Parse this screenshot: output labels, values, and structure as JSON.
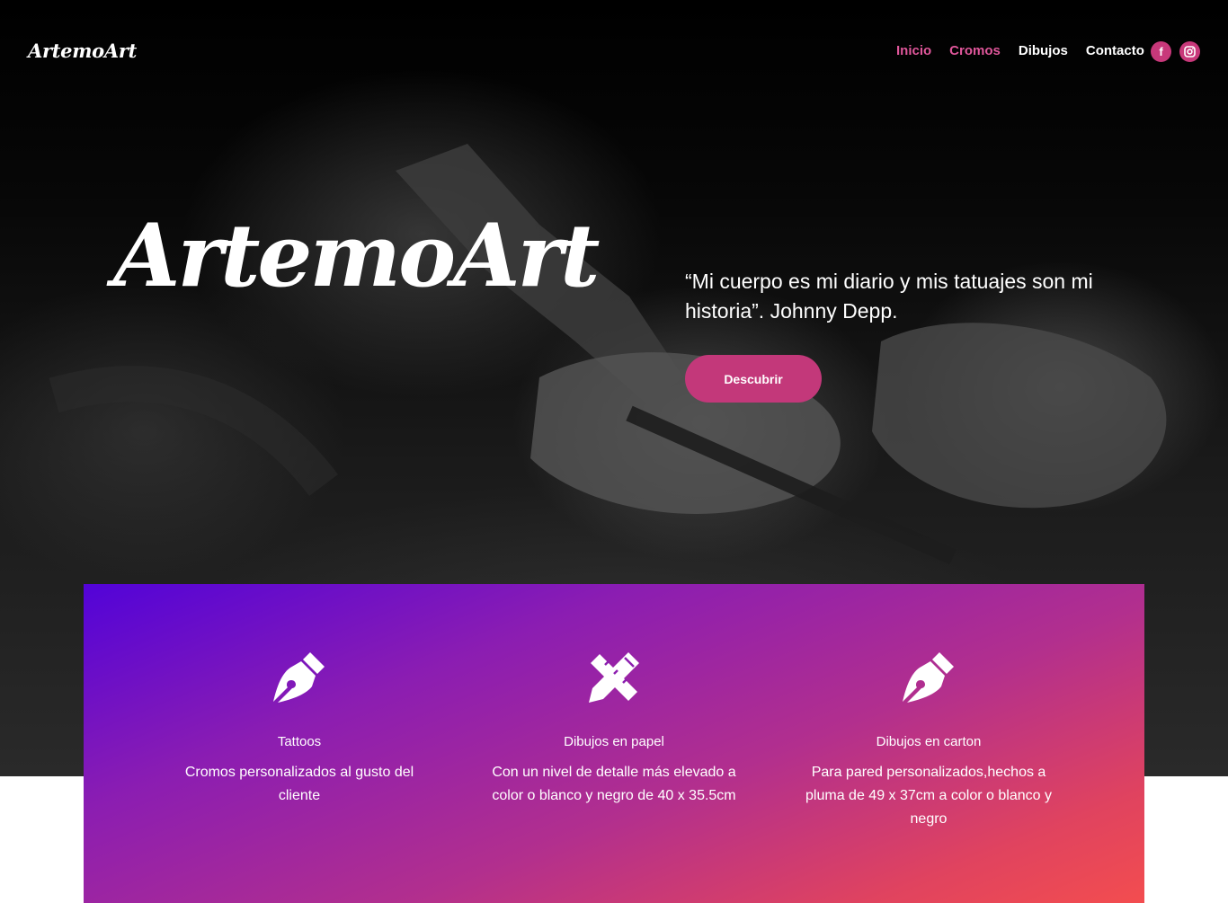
{
  "header": {
    "brand": "ArtemoArt",
    "nav": [
      {
        "label": "Inicio",
        "active": true
      },
      {
        "label": "Cromos",
        "active": true
      },
      {
        "label": "Dibujos",
        "active": false
      },
      {
        "label": "Contacto",
        "active": false
      }
    ],
    "social": [
      {
        "icon": "facebook-icon",
        "glyph": "f"
      },
      {
        "icon": "instagram-icon",
        "glyph": "◎"
      }
    ]
  },
  "hero": {
    "logo": "ArtemoArt",
    "quote": "“Mi cuerpo es mi diario y mis tatuajes son mi historia”. Johnny Depp.",
    "cta_label": "Descubrir"
  },
  "features": [
    {
      "icon": "fountain-pen-icon",
      "title": "Tattoos",
      "description": "Cromos personalizados al gusto del cliente"
    },
    {
      "icon": "pencil-ruler-icon",
      "title": "Dibujos en papel",
      "description": "Con un nivel de detalle más elevado a color o blanco y negro de 40 x 35.5cm"
    },
    {
      "icon": "fountain-pen-icon",
      "title": "Dibujos en carton",
      "description": "Para pared personalizados,hechos a pluma de 49 x 37cm a color o blanco y negro"
    }
  ],
  "colors": {
    "accent": "#c3387a",
    "nav_active": "#e0579b",
    "gradient_start": "#5203d8",
    "gradient_end": "#f34d4f"
  }
}
